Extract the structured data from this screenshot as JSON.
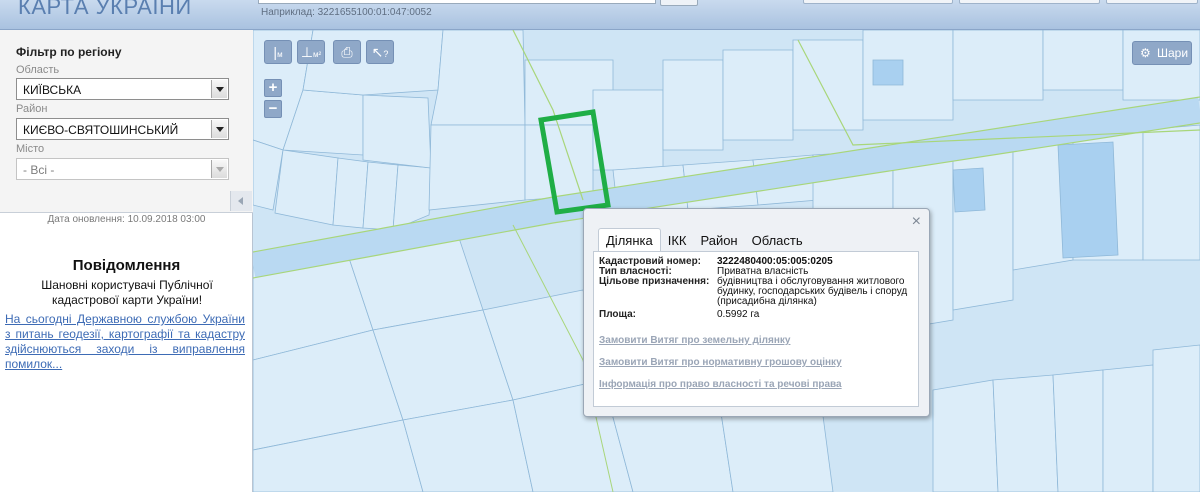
{
  "header": {
    "title": "КАРТА УКРАЇНИ",
    "search_hint": "Наприклад: 3221655100:01:047:0052"
  },
  "filter": {
    "title": "Фільтр по регіону",
    "region_label": "Область",
    "region_value": "КИЇВСЬКА",
    "district_label": "Район",
    "district_value": "КИЄВО-СВЯТОШИНСЬКИЙ",
    "city_label": "Місто",
    "city_value": "- Всі -",
    "update_date": "Дата оновлення: 10.09.2018 03:00"
  },
  "notice": {
    "title": "Повідомлення",
    "greeting": "Шановні користувачі Публічної кадастрової карти України!",
    "link_text": "На сьогодні Державною службою України з питань геодезії, картографії та кадастру здійснюються заходи із виправлення помилок..."
  },
  "map": {
    "zoom_in": "+",
    "zoom_out": "−",
    "layers_label": "Шари",
    "tools": [
      {
        "icon": "measure-length-icon",
        "glyph": "|"
      },
      {
        "icon": "measure-area-icon",
        "glyph": "⊥"
      },
      {
        "icon": "print-icon",
        "glyph": "⎙"
      },
      {
        "icon": "info-cursor-icon",
        "glyph": "↖"
      }
    ],
    "tool_subscripts": [
      "м",
      "м²",
      "",
      "?"
    ],
    "colors": {
      "background": "#cfe5f5",
      "parcel_fill": "#dcedf9",
      "parcel_stroke": "#8fb8d8",
      "road_stroke": "#a8d67a",
      "highlight": "#1fae46"
    }
  },
  "popup": {
    "close": "×",
    "tabs": [
      "Ділянка",
      "ІКК",
      "Район",
      "Область"
    ],
    "active_tab": "Ділянка",
    "fields": {
      "cadastral_label": "Кадастровий номер:",
      "cadastral_value": "3222480400:05:005:0205",
      "ownership_label": "Тип власності:",
      "ownership_value": "Приватна власність",
      "purpose_label": "Цільове призначення:",
      "purpose_value": "будівництва і обслуговування житлового будинку, господарських будівель і споруд (присадибна ділянка)",
      "area_label": "Площа:",
      "area_value": "0.5992 га"
    },
    "links": [
      "Замовити Витяг про земельну ділянку",
      "Замовити Витяг про нормативну грошову оцінку",
      "Інформація про право власності та речові права"
    ]
  }
}
